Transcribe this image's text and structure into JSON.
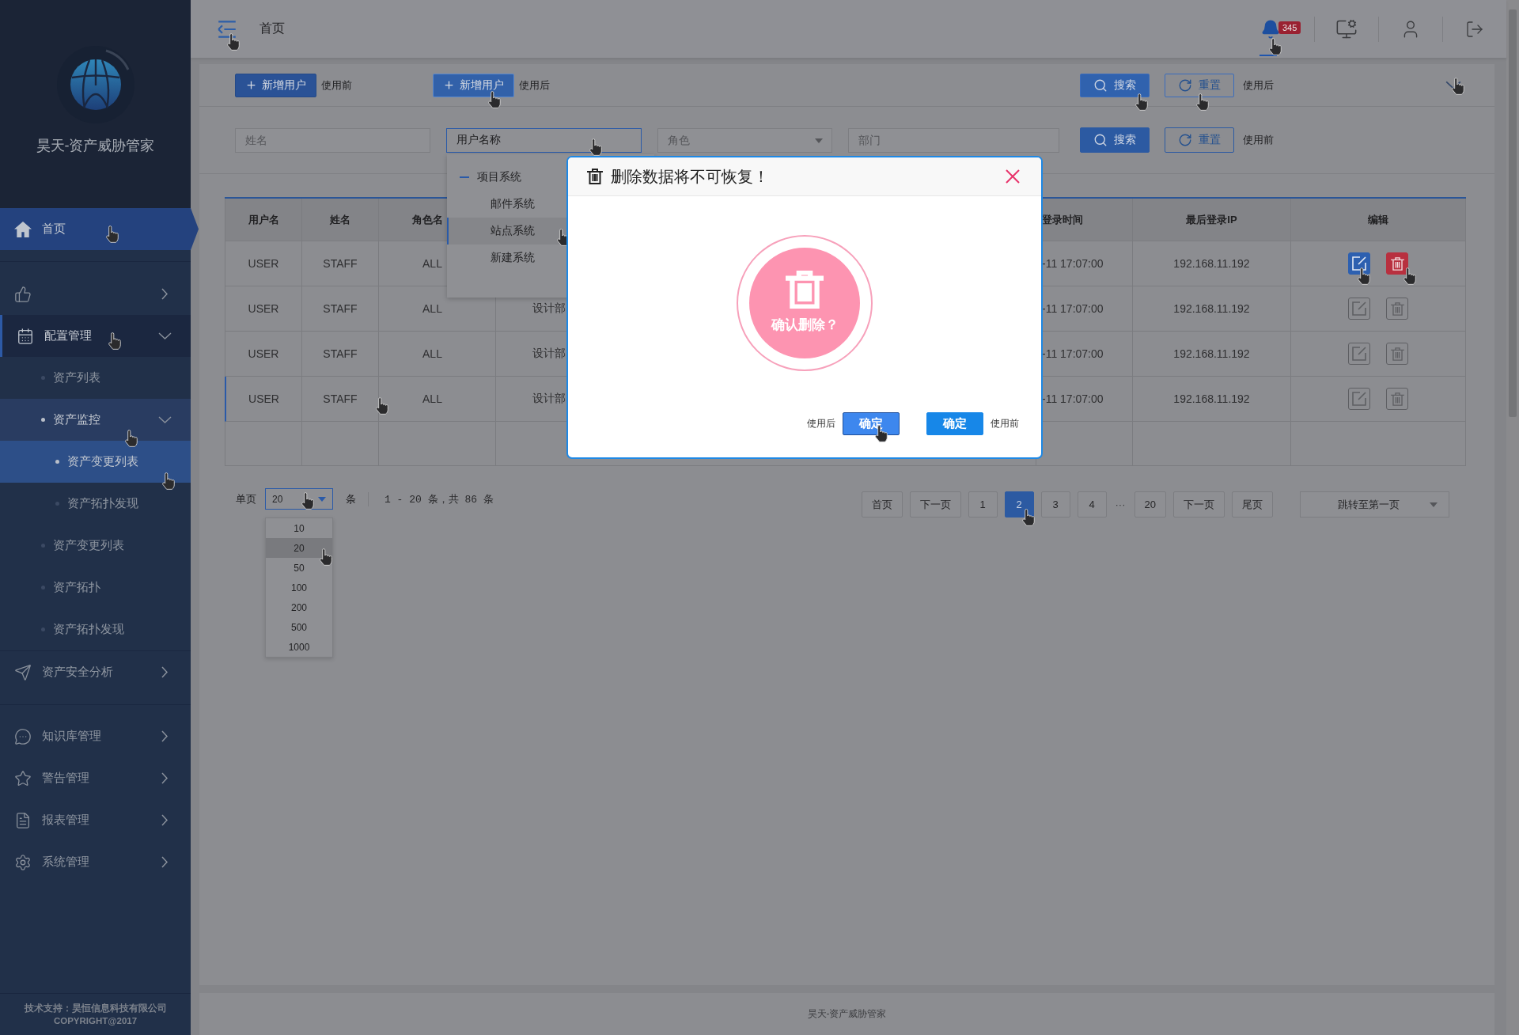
{
  "sidebar": {
    "title": "昊天-资产威胁管家",
    "sections": [
      {
        "items": [
          {
            "kind": "link",
            "label": "首页",
            "selected": true,
            "hover": true
          }
        ]
      },
      {
        "items": [
          {
            "kind": "group",
            "expanded": false,
            "selected": false,
            "hover": false
          },
          {
            "kind": "group",
            "label": "配置管理",
            "expanded": true,
            "selected": false,
            "hover": true,
            "children": [
              {
                "kind": "link",
                "label": "资产列表",
                "selected": false,
                "hover": false
              },
              {
                "kind": "group",
                "label": "资产监控",
                "expanded": true,
                "selected": false,
                "hover": true,
                "children": [
                  {
                    "kind": "link",
                    "label": "资产变更列表",
                    "selected": true,
                    "hover": true
                  },
                  {
                    "kind": "link",
                    "label": "资产拓扑发现",
                    "selected": false,
                    "hover": false
                  }
                ]
              },
              {
                "kind": "link",
                "label": "资产变更列表",
                "selected": false,
                "hover": false
              },
              {
                "kind": "link",
                "label": "资产拓扑",
                "selected": false,
                "hover": false
              },
              {
                "kind": "link",
                "label": "资产拓扑发现",
                "selected": false,
                "hover": false
              }
            ]
          }
        ]
      },
      {
        "items": [
          {
            "kind": "group",
            "label": "资产安全分析",
            "expanded": false,
            "selected": false,
            "hover": false
          }
        ]
      },
      {
        "items": [
          {
            "kind": "group",
            "label": "知识库管理",
            "expanded": false,
            "selected": false,
            "hover": false
          },
          {
            "kind": "group",
            "label": "警告管理",
            "expanded": false,
            "selected": false,
            "hover": false
          },
          {
            "kind": "group",
            "label": "报表管理",
            "expanded": false,
            "selected": false,
            "hover": false
          },
          {
            "kind": "group",
            "label": "系统管理",
            "expanded": false,
            "selected": false,
            "hover": false
          }
        ]
      }
    ],
    "footer": {
      "support": "技术支持：昊恒信息科技有限公司",
      "copyright": "COPYRIGHT@2017"
    }
  },
  "header": {
    "title": "首页",
    "toggle": {
      "hover": true
    },
    "actions": [
      {
        "badge": "345",
        "selected": true,
        "hover": true
      },
      {
        "selected": false,
        "hover": false
      },
      {
        "selected": false,
        "hover": false
      },
      {
        "selected": false,
        "hover": false
      }
    ]
  },
  "toolbar": {
    "add_buttons": [
      {
        "label": "新增用户",
        "note": "使用前",
        "hover": false
      },
      {
        "label": "新增用户",
        "note": "使用后",
        "hover": true
      }
    ],
    "buttons": [
      {
        "kind": "search",
        "label": "搜索",
        "hover": true
      },
      {
        "kind": "reset",
        "label": "重置",
        "hover": true
      }
    ],
    "note": "使用后",
    "collapse": {
      "hover": true
    }
  },
  "filters": {
    "fields": [
      {
        "kind": "input",
        "placeholder": "姓名",
        "focused": false,
        "hover": false
      },
      {
        "kind": "tree-select",
        "value": "用户名称",
        "focused": true,
        "hover": true,
        "dropdown": [
          {
            "label": "项目系统",
            "expanded": true,
            "children": [
              {
                "label": "邮件系统",
                "hover": false
              },
              {
                "label": "站点系统",
                "hover": true
              },
              {
                "label": "新建系统",
                "hover": false
              }
            ]
          }
        ]
      },
      {
        "kind": "select",
        "placeholder": "角色",
        "focused": false,
        "hover": false
      },
      {
        "kind": "input",
        "placeholder": "部门",
        "focused": false,
        "hover": false
      }
    ],
    "buttons": [
      {
        "kind": "search",
        "label": "搜索",
        "hover": false
      },
      {
        "kind": "reset",
        "label": "重置",
        "hover": false
      }
    ],
    "note": "使用前"
  },
  "table": {
    "columns": [
      {
        "title": "用户名"
      },
      {
        "title": "姓名"
      },
      {
        "title": "角色名"
      },
      {},
      {
        "title": "登录时间"
      },
      {
        "title": "最后登录IP"
      },
      {
        "title": "编辑"
      }
    ],
    "rows": [
      {
        "cells": [
          "USER",
          "STAFF",
          "ALL",
          null,
          "-11 17:07:00",
          "192.168.11.192"
        ],
        "hover": false,
        "actions": [
          {
            "kind": "edit",
            "hover": true
          },
          {
            "kind": "delete",
            "hover": true
          }
        ]
      },
      {
        "cells": [
          "USER",
          "STAFF",
          "ALL",
          "设计部",
          "-11 17:07:00",
          "192.168.11.192"
        ],
        "hover": false,
        "actions": [
          {
            "kind": "edit",
            "hover": false
          },
          {
            "kind": "delete",
            "hover": false
          }
        ]
      },
      {
        "cells": [
          "USER",
          "STAFF",
          "ALL",
          "设计部",
          "-11 17:07:00",
          "192.168.11.192"
        ],
        "hover": false,
        "actions": [
          {
            "kind": "edit",
            "hover": false
          },
          {
            "kind": "delete",
            "hover": false
          }
        ]
      },
      {
        "cells": [
          "USER",
          "STAFF",
          "ALL",
          "设计部",
          "-11 17:07:00",
          "192.168.11.192"
        ],
        "hover": true,
        "actions": [
          {
            "kind": "edit",
            "hover": false
          },
          {
            "kind": "delete",
            "hover": false
          }
        ]
      }
    ]
  },
  "pagination": {
    "size_label": "单页",
    "size_select": {
      "value": "20",
      "open": true,
      "hover": true,
      "options": [
        {
          "label": "10",
          "selected": false,
          "hover": false
        },
        {
          "label": "20",
          "selected": true,
          "hover": true
        },
        {
          "label": "50",
          "selected": false,
          "hover": false
        },
        {
          "label": "100",
          "selected": false,
          "hover": false
        },
        {
          "label": "200",
          "selected": false,
          "hover": false
        },
        {
          "label": "500",
          "selected": false,
          "hover": false
        },
        {
          "label": "1000",
          "selected": false,
          "hover": false
        }
      ]
    },
    "unit": "条",
    "summary": "1 - 20 条，共 86 条",
    "pages": [
      {
        "kind": "button",
        "label": "首页",
        "selected": false,
        "hover": false
      },
      {
        "kind": "button",
        "label": "下一页",
        "selected": false,
        "hover": false
      },
      {
        "kind": "button",
        "label": "1",
        "selected": false,
        "hover": false
      },
      {
        "kind": "button",
        "label": "2",
        "selected": true,
        "hover": true
      },
      {
        "kind": "button",
        "label": "3",
        "selected": false,
        "hover": false
      },
      {
        "kind": "button",
        "label": "4",
        "selected": false,
        "hover": false
      },
      {
        "kind": "ellipsis",
        "label": "···",
        "selected": false,
        "hover": false
      },
      {
        "kind": "button",
        "label": "20",
        "selected": false,
        "hover": false
      },
      {
        "kind": "button",
        "label": "下一页",
        "selected": false,
        "hover": false
      },
      {
        "kind": "button",
        "label": "尾页",
        "selected": false,
        "hover": false
      }
    ],
    "jump": {
      "value": "跳转至第一页"
    }
  },
  "dialog": {
    "title": "删除数据将不可恢复！",
    "prompt": "确认删除？",
    "buttons": [
      {
        "label": "确定",
        "note": "使用后",
        "hover": true
      },
      {
        "label": "确定",
        "note": "使用前",
        "hover": false
      }
    ]
  },
  "footer": {
    "text": "昊天-资产威胁管家"
  }
}
